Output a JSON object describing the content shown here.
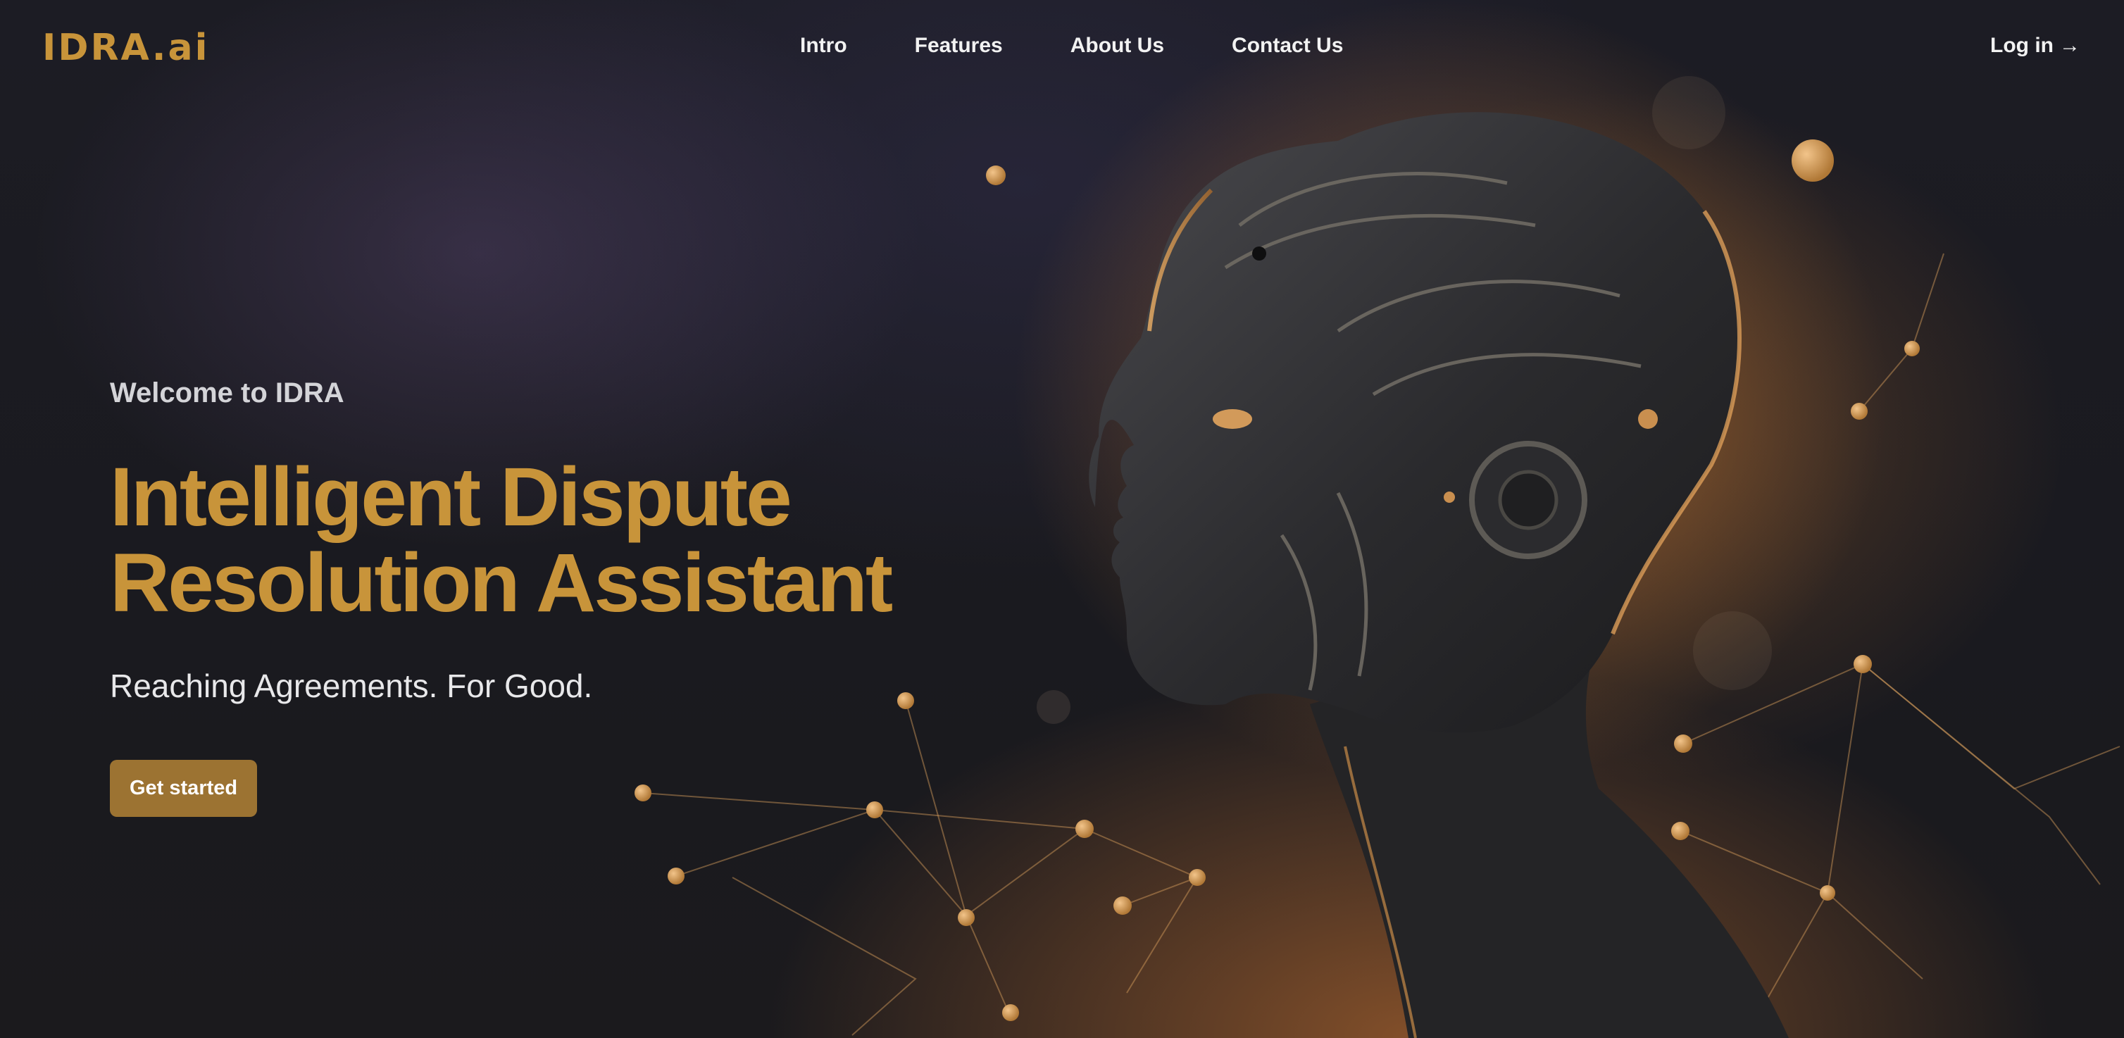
{
  "nav": {
    "logo": "IDRA.ai",
    "links": [
      {
        "label": "Intro"
      },
      {
        "label": "Features"
      },
      {
        "label": "About Us"
      },
      {
        "label": "Contact Us"
      }
    ],
    "login_label": "Log in",
    "login_arrow": "→"
  },
  "hero": {
    "welcome": "Welcome to IDRA",
    "title_line1": "Intelligent Dispute",
    "title_line2": "Resolution Assistant",
    "tagline": "Reaching Agreements. For Good.",
    "cta_label": "Get started"
  },
  "theme": {
    "accent": "#c8943a",
    "button": "#9c7332",
    "background": "#191a1e"
  },
  "illustration": "robot-head-profile-with-circuitry"
}
